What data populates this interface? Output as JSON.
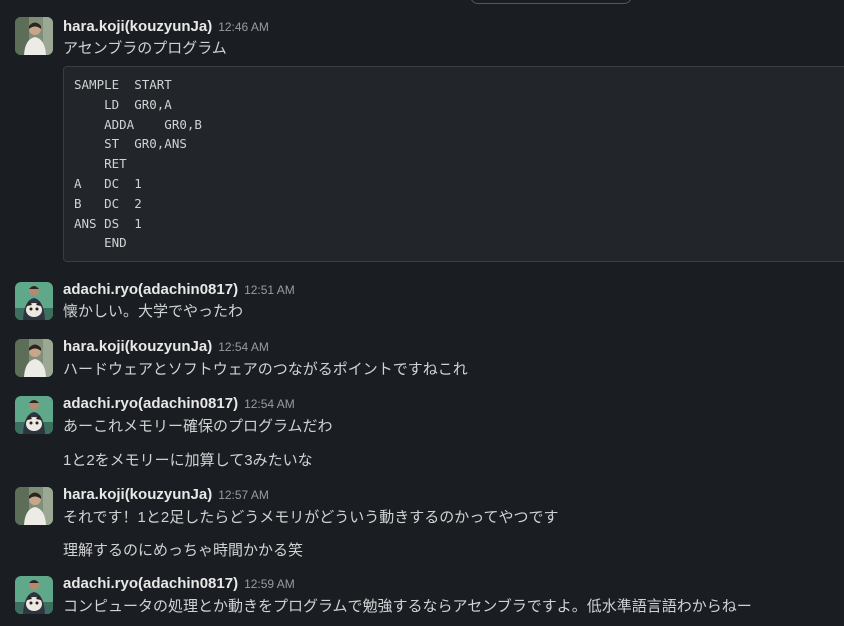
{
  "messages": [
    {
      "user": "hara.koji(kouzyunJa)",
      "time": "12:46 AM",
      "lines": [
        "アセンブラのプログラム"
      ],
      "code": "SAMPLE  START\n    LD  GR0,A\n    ADDA    GR0,B\n    ST  GR0,ANS\n    RET\nA   DC  1\nB   DC  2\nANS DS  1\n    END"
    },
    {
      "user": "adachi.ryo(adachin0817)",
      "time": "12:51 AM",
      "lines": [
        "懐かしい。大学でやったわ"
      ]
    },
    {
      "user": "hara.koji(kouzyunJa)",
      "time": "12:54 AM",
      "lines": [
        "ハードウェアとソフトウェアのつながるポイントですねこれ"
      ]
    },
    {
      "user": "adachi.ryo(adachin0817)",
      "time": "12:54 AM",
      "lines": [
        "あーこれメモリー確保のプログラムだわ",
        "1と2をメモリーに加算して3みたいな"
      ]
    },
    {
      "user": "hara.koji(kouzyunJa)",
      "time": "12:57 AM",
      "lines": [
        "それです！1と2足したらどうメモリがどういう動きするのかってやつです",
        "理解するのにめっちゃ時間かかる笑"
      ]
    },
    {
      "user": "adachi.ryo(adachin0817)",
      "time": "12:59 AM",
      "lines": [
        "コンピュータの処理とか動きをプログラムで勉強するならアセンブラですよ。低水準語言語わからねー"
      ]
    }
  ],
  "colors": {
    "background": "#1a1d21",
    "text": "#d1d2d3",
    "username": "#e8e8e8",
    "timestamp": "#9a9b9d",
    "code_bg": "#222529"
  },
  "icons": {
    "hara_avatar": "person-photo-avatar",
    "adachi_avatar": "person-with-dog-avatar"
  }
}
